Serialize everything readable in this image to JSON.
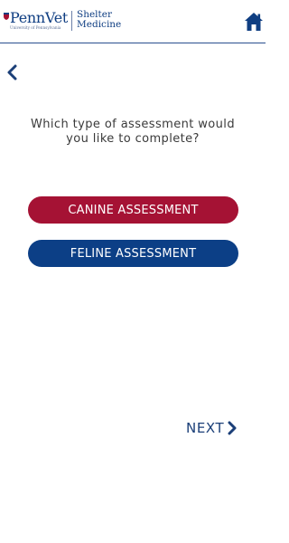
{
  "header": {
    "logo": {
      "brand": "PennVet",
      "tagline": "University of Pennsylvania",
      "program_line1": "Shelter",
      "program_line2": "Medicine"
    },
    "home_icon": "home-icon",
    "colors": {
      "brand_blue": "#0f3e82",
      "rule": "#2a4f8f"
    }
  },
  "nav": {
    "back_icon": "chevron-left-icon"
  },
  "main": {
    "prompt": "Which type of assessment would you like to complete?",
    "options": [
      {
        "label": "CANINE ASSESSMENT",
        "color": "#a51234"
      },
      {
        "label": "FELINE ASSESSMENT",
        "color": "#0c3f86"
      }
    ]
  },
  "footer": {
    "next_label": "NEXT",
    "next_icon": "chevron-right-icon"
  }
}
